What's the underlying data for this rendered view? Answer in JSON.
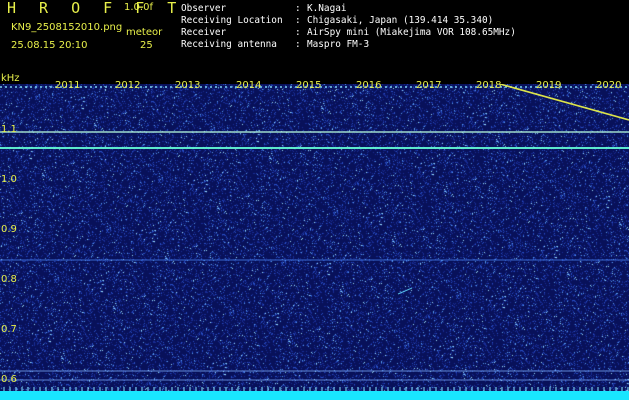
{
  "header": {
    "title": "H R O F F T",
    "version": "1.0.0f",
    "filename": "KN9_2508152010.png",
    "mode": "meteor",
    "timestamp": "25.08.15 20:10",
    "counter": "25"
  },
  "info": [
    {
      "label": "Observer",
      "value": "K.Nagai"
    },
    {
      "label": "Receiving Location",
      "value": "Chigasaki, Japan (139.414 35.340)"
    },
    {
      "label": "Receiver",
      "value": "AirSpy mini (Miakejima VOR 108.65MHz)"
    },
    {
      "label": "Receiving antenna",
      "value": "Maspro FM-3"
    }
  ],
  "axis": {
    "unit": "kHz",
    "yticks": [
      "1.1",
      "1.0",
      "0.9",
      "0.8",
      "0.7",
      "0.6"
    ],
    "years": [
      "2011",
      "2012",
      "2013",
      "2014",
      "2015",
      "2016",
      "2017",
      "2018",
      "2019",
      "2020"
    ]
  },
  "colors": {
    "label_yellow": "#e8f04a",
    "background_blue": "#08115a",
    "baseline_cyan": "#19e6ff"
  }
}
